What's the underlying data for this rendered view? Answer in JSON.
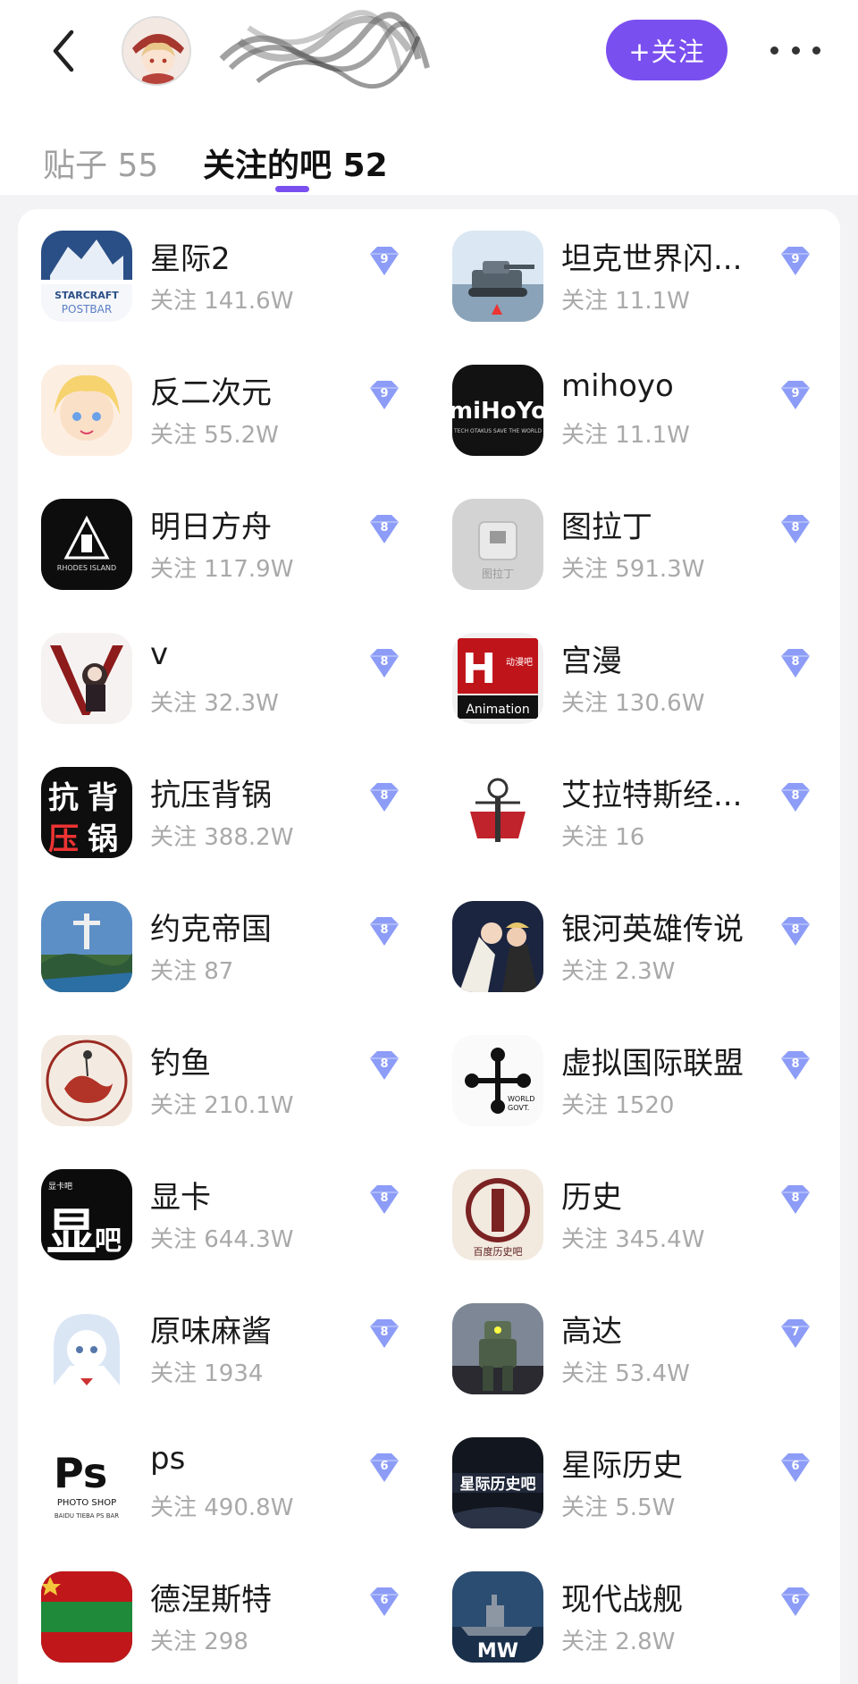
{
  "header": {
    "follow_label": "+关注",
    "back_icon": "chevron-left-icon",
    "more_icon": "more-horizontal-icon"
  },
  "tabs": {
    "posts_label": "贴子 55",
    "bars_label": "关注的吧 52"
  },
  "colors": {
    "accent": "#7a4ff0",
    "badge": "#8c9cf7",
    "meta_text": "#a9a9a9"
  },
  "forums": [
    {
      "name": "星际2",
      "followers": "关注 141.6W",
      "level": "9"
    },
    {
      "name": "坦克世界闪...",
      "followers": "关注 11.1W",
      "level": "9"
    },
    {
      "name": "反二次元",
      "followers": "关注 55.2W",
      "level": "9"
    },
    {
      "name": "mihoyo",
      "followers": "关注 11.1W",
      "level": "9"
    },
    {
      "name": "明日方舟",
      "followers": "关注 117.9W",
      "level": "8"
    },
    {
      "name": "图拉丁",
      "followers": "关注 591.3W",
      "level": "8"
    },
    {
      "name": "v",
      "followers": "关注 32.3W",
      "level": "8"
    },
    {
      "name": "宫漫",
      "followers": "关注 130.6W",
      "level": "8"
    },
    {
      "name": "抗压背锅",
      "followers": "关注 388.2W",
      "level": "8"
    },
    {
      "name": "艾拉特斯经...",
      "followers": "关注 16",
      "level": "8"
    },
    {
      "name": "约克帝国",
      "followers": "关注 87",
      "level": "8"
    },
    {
      "name": "银河英雄传说",
      "followers": "关注 2.3W",
      "level": "8"
    },
    {
      "name": "钓鱼",
      "followers": "关注 210.1W",
      "level": "8"
    },
    {
      "name": "虚拟国际联盟",
      "followers": "关注 1520",
      "level": "8"
    },
    {
      "name": "显卡",
      "followers": "关注 644.3W",
      "level": "8"
    },
    {
      "name": "历史",
      "followers": "关注 345.4W",
      "level": "8"
    },
    {
      "name": "原味麻酱",
      "followers": "关注 1934",
      "level": "8"
    },
    {
      "name": "高达",
      "followers": "关注 53.4W",
      "level": "7"
    },
    {
      "name": "ps",
      "followers": "关注 490.8W",
      "level": "6"
    },
    {
      "name": "星际历史",
      "followers": "关注 5.5W",
      "level": "6"
    },
    {
      "name": "德涅斯特",
      "followers": "关注 298",
      "level": "6"
    },
    {
      "name": "现代战舰",
      "followers": "关注 2.8W",
      "level": "6"
    }
  ]
}
